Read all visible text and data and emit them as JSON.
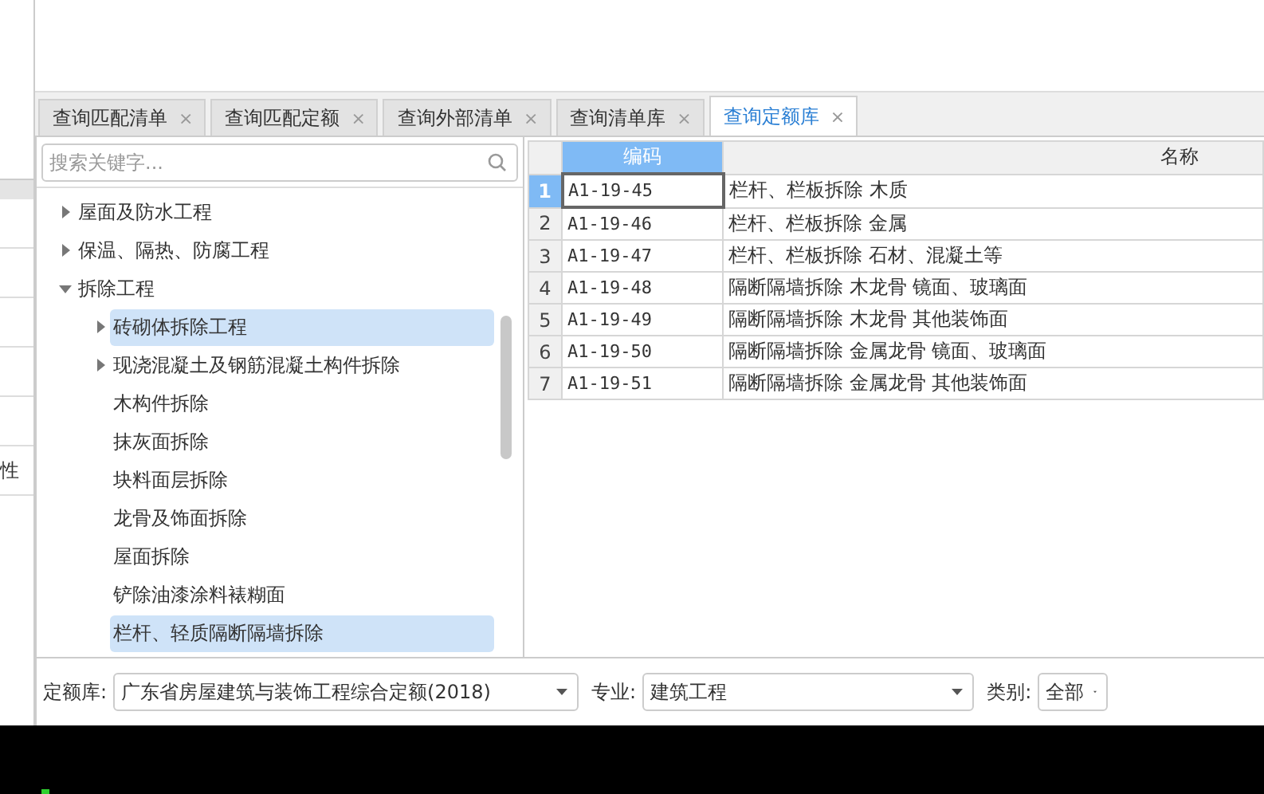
{
  "side_panel": {
    "text": "性"
  },
  "tabs": [
    {
      "label": "查询匹配清单",
      "selected": false
    },
    {
      "label": "查询匹配定额",
      "selected": false
    },
    {
      "label": "查询外部清单",
      "selected": false
    },
    {
      "label": "查询清单库",
      "selected": false
    },
    {
      "label": "查询定额库",
      "selected": true
    }
  ],
  "close_glyph": "×",
  "search": {
    "placeholder": "搜索关键字..."
  },
  "tree": [
    {
      "label": "屋面及防水工程",
      "expanded": false,
      "selected": false
    },
    {
      "label": "保温、隔热、防腐工程",
      "expanded": false,
      "selected": false
    },
    {
      "label": "拆除工程",
      "expanded": true,
      "selected": false,
      "children": [
        {
          "label": "砖砌体拆除工程",
          "expanded": false,
          "selected": true
        },
        {
          "label": "现浇混凝土及钢筋混凝土构件拆除",
          "expanded": false,
          "selected": false
        },
        {
          "label": "木构件拆除",
          "selected": false
        },
        {
          "label": "抹灰面拆除",
          "selected": false
        },
        {
          "label": "块料面层拆除",
          "selected": false
        },
        {
          "label": "龙骨及饰面拆除",
          "selected": false
        },
        {
          "label": "屋面拆除",
          "selected": false
        },
        {
          "label": "铲除油漆涂料裱糊面",
          "selected": false
        },
        {
          "label": "栏杆、轻质隔断隔墙拆除",
          "selected": true
        }
      ]
    }
  ],
  "grid": {
    "columns": [
      "编码",
      "名称"
    ],
    "rows": [
      {
        "number": "1",
        "code": "A1-19-45",
        "name": "栏杆、栏板拆除 木质",
        "selected": true
      },
      {
        "number": "2",
        "code": "A1-19-46",
        "name": "栏杆、栏板拆除 金属",
        "selected": false
      },
      {
        "number": "3",
        "code": "A1-19-47",
        "name": "栏杆、栏板拆除 石材、混凝土等",
        "selected": false
      },
      {
        "number": "4",
        "code": "A1-19-48",
        "name": "隔断隔墙拆除 木龙骨 镜面、玻璃面",
        "selected": false
      },
      {
        "number": "5",
        "code": "A1-19-49",
        "name": "隔断隔墙拆除 木龙骨 其他装饰面",
        "selected": false
      },
      {
        "number": "6",
        "code": "A1-19-50",
        "name": "隔断隔墙拆除 金属龙骨 镜面、玻璃面",
        "selected": false
      },
      {
        "number": "7",
        "code": "A1-19-51",
        "name": "隔断隔墙拆除 金属龙骨 其他装饰面",
        "selected": false
      }
    ]
  },
  "filters": [
    {
      "label": "定额库:",
      "value": "广东省房屋建筑与装饰工程综合定额(2018)"
    },
    {
      "label": "专业:",
      "value": "建筑工程"
    },
    {
      "label": "类别:",
      "value": "全部"
    }
  ]
}
